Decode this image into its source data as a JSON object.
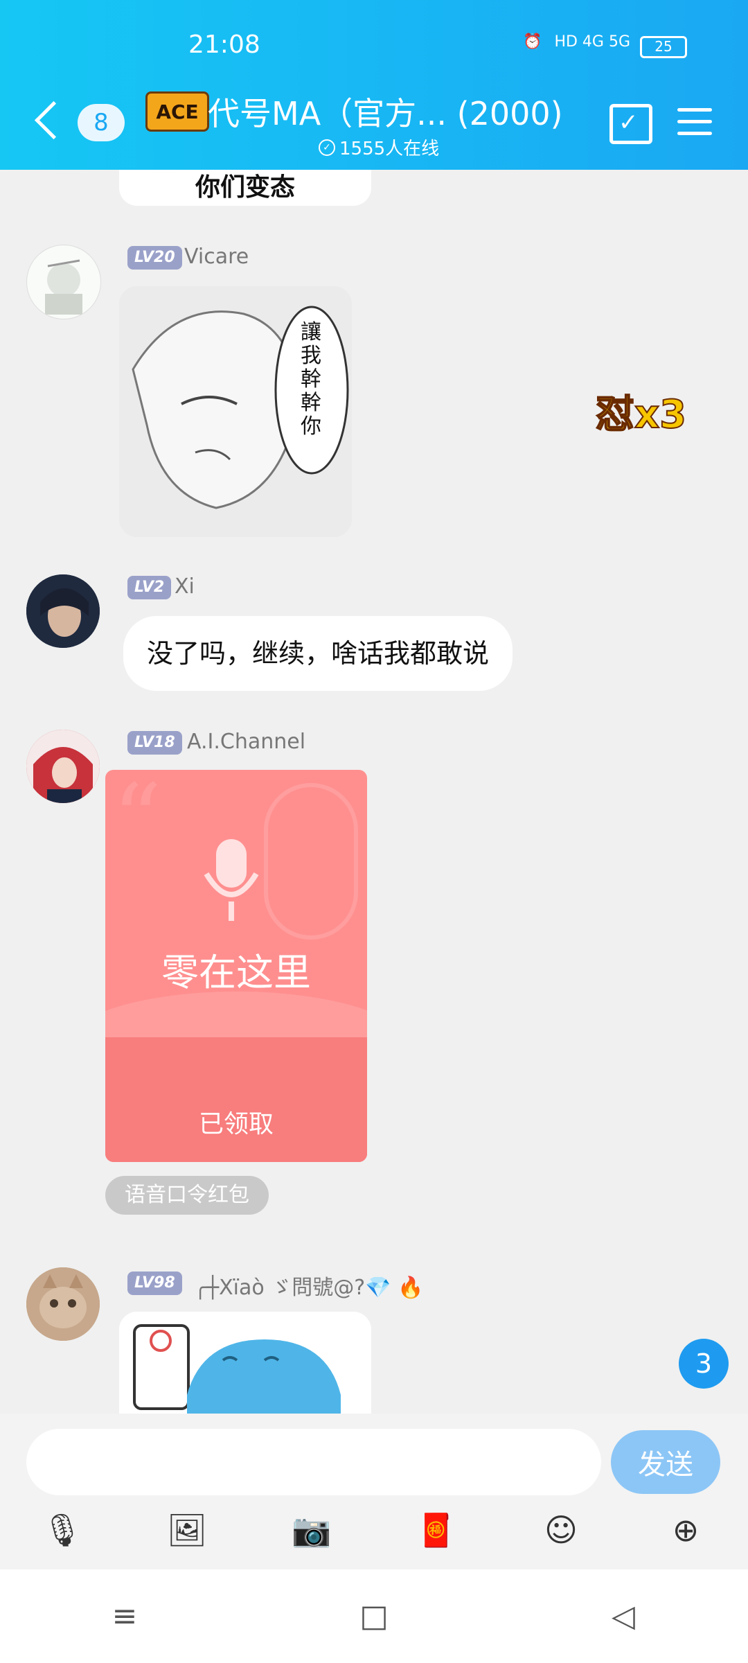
{
  "status_bar": {
    "time": "21:08",
    "network": "HD 4G 5G",
    "battery": "25"
  },
  "header": {
    "back_count": "8",
    "logo_text": "ACE",
    "title": "代号MA（官方... (2000)",
    "online": "1555人在线"
  },
  "top_partial_message": {
    "caption": "你们变态"
  },
  "combo_label": "怼x3",
  "messages": [
    {
      "level": "LV20",
      "name": "Vicare",
      "type": "image",
      "image_text": "讓我幹幹你"
    },
    {
      "level": "LV2",
      "name": "Xi",
      "type": "text",
      "text": "没了吗，继续，啥话我都敢说"
    },
    {
      "level": "LV18",
      "name": "A.I.Channel",
      "type": "red_packet",
      "packet_text": "零在这里",
      "packet_status": "已领取",
      "packet_tag": "语音口令红包"
    },
    {
      "level": "LV98",
      "name": "╭┼Xïaò ゞ問號@?💎 🔥",
      "type": "image_partial"
    }
  ],
  "unread_badge": "3",
  "input": {
    "placeholder": "",
    "send_label": "发送"
  },
  "toolbar": {
    "items": [
      "mic-icon",
      "image-icon",
      "camera-icon",
      "red-packet-icon",
      "emoji-icon",
      "plus-icon"
    ]
  },
  "system_nav": {
    "items": [
      "recents-icon",
      "home-icon",
      "back-icon"
    ]
  },
  "colors": {
    "header_start": "#16c7f4",
    "header_end": "#1aa8f3",
    "send_button": "#8cc6f6",
    "red_packet": "#ff8f8f",
    "unread": "#1e9bf0"
  }
}
